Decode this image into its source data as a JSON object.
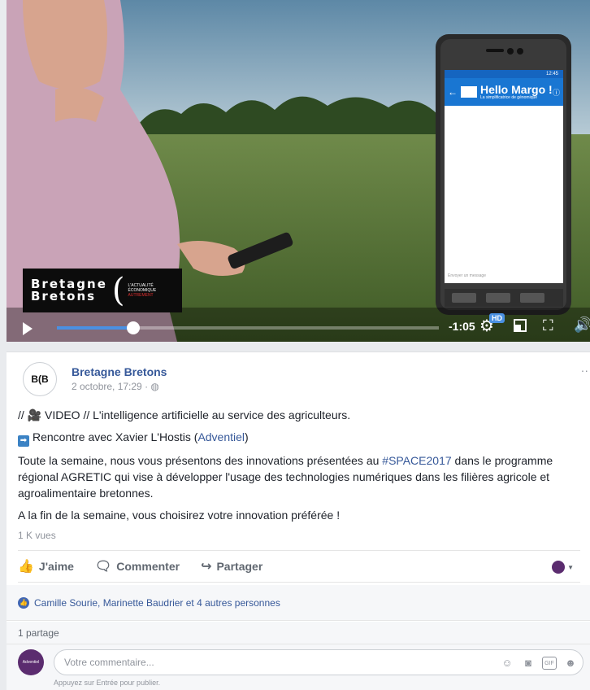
{
  "video": {
    "logo_line1": "Bretagne",
    "logo_line2": "Bretons",
    "logo_tag1": "L'ACTUALITÉ",
    "logo_tag2": "ÉCONOMIQUE",
    "logo_tag3": "AUTREMENT",
    "phone_title": "Hello Margo !",
    "phone_subtitle": "La simplificatrice de génomique",
    "phone_status": "12:45",
    "phone_input_placeholder": "Envoyer un message",
    "time_remaining": "-1:05",
    "hd_label": "HD",
    "progress": 0.2
  },
  "post": {
    "page_name": "Bretagne Bretons",
    "avatar_text": "B(B",
    "timestamp": "2 octobre, 17:29 ·",
    "line1": "// 🎥 VIDEO // L'intelligence artificielle au service des agriculteurs.",
    "line2_prefix": "Rencontre avec Xavier L'Hostis (",
    "line2_link": "Adventiel",
    "line2_suffix": ")",
    "para1_prefix": "Toute la semaine, nous vous présentons des innovations présentées au ",
    "para1_hashtag": "#SPACE2017",
    "para1_suffix": " dans le programme régional AGRETIC qui vise à développer l'usage des technologies numériques dans les filières agricole et agroalimentaire bretonnes.",
    "para2": "A la fin de la semaine, vous choisirez votre innovation préférée !",
    "views": "1 K vues"
  },
  "actions": {
    "like": "J'aime",
    "comment": "Commenter",
    "share": "Partager"
  },
  "reactions": "Camille Sourie, Marinette Baudrier et 4 autres personnes",
  "shares": "1 partage",
  "comment_box": {
    "avatar_text": "Adventiel",
    "placeholder": "Votre commentaire...",
    "hint": "Appuyez sur Entrée pour publier."
  },
  "colors": {
    "link": "#365899",
    "accent": "#4a90e2"
  }
}
